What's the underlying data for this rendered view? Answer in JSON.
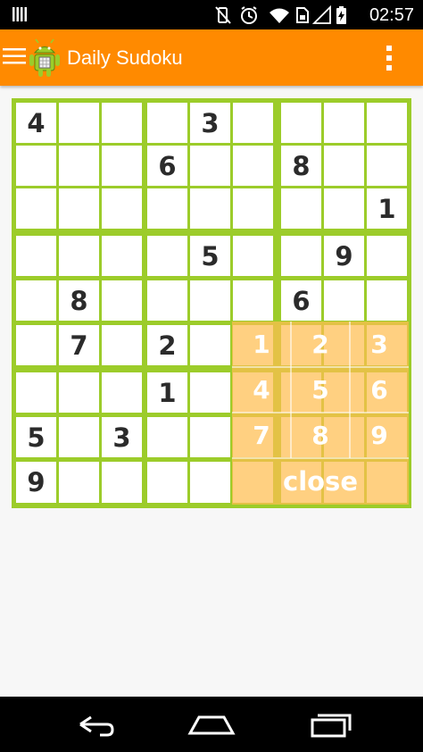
{
  "status_bar": {
    "time": "02:57",
    "icons": [
      "notification-bars-icon",
      "vibrate-off-icon",
      "alarm-icon",
      "wifi-icon",
      "sim-icon",
      "signal-icon",
      "battery-charging-icon"
    ]
  },
  "action_bar": {
    "title": "Daily Sudoku",
    "color": "#ff8a00"
  },
  "board": {
    "grid_color": "#9ccc2a",
    "rows": [
      [
        "4",
        "",
        "",
        "",
        "3",
        "",
        "",
        "",
        ""
      ],
      [
        "",
        "",
        "",
        "6",
        "",
        "",
        "8",
        "",
        ""
      ],
      [
        "",
        "",
        "",
        "",
        "",
        "",
        "",
        "",
        "1"
      ],
      [
        "",
        "",
        "",
        "",
        "5",
        "",
        "",
        "9",
        ""
      ],
      [
        "",
        "8",
        "",
        "",
        "",
        "",
        "6",
        "",
        ""
      ],
      [
        "",
        "7",
        "",
        "2",
        "",
        "",
        "",
        "",
        ""
      ],
      [
        "",
        "",
        "",
        "1",
        "",
        "",
        "",
        "",
        ""
      ],
      [
        "5",
        "",
        "3",
        "",
        "",
        "",
        "",
        "",
        ""
      ],
      [
        "9",
        "",
        "",
        "",
        "",
        "",
        "",
        "",
        ""
      ]
    ]
  },
  "picker": {
    "keys": [
      "1",
      "2",
      "3",
      "4",
      "5",
      "6",
      "7",
      "8",
      "9"
    ],
    "close_label": "close",
    "color": "#ffbe50"
  },
  "nav_bar": {
    "buttons": [
      "back-icon",
      "home-icon",
      "recents-icon"
    ]
  }
}
